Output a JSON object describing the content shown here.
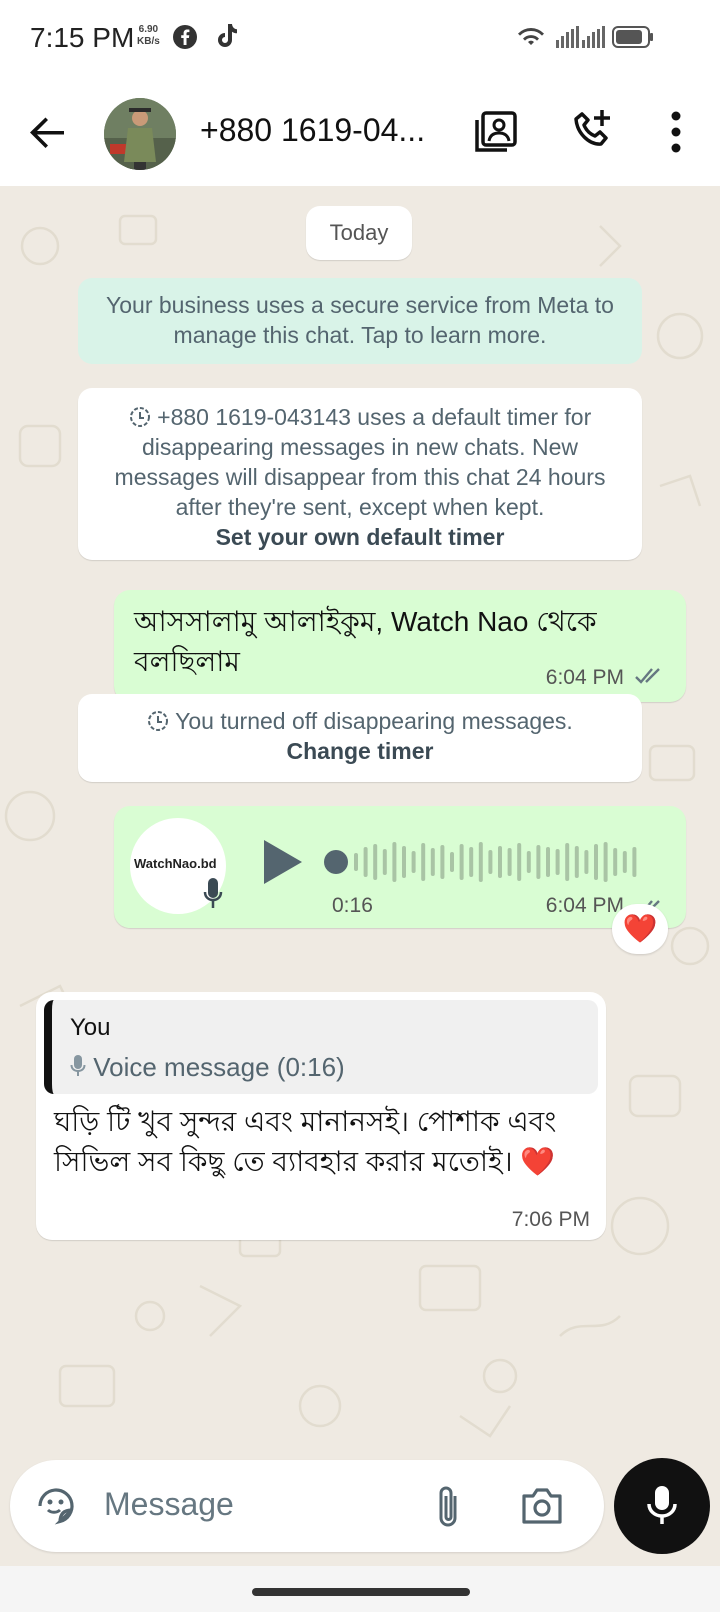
{
  "status_bar": {
    "time": "7:15 PM",
    "speed_value": "6.90",
    "speed_unit": "KB/s",
    "icons": [
      "facebook-icon",
      "tiktok-icon",
      "wifi-icon",
      "signal-icon",
      "signal-icon",
      "battery-icon"
    ]
  },
  "header": {
    "contact_name": "+880 1619-04...",
    "icons": [
      "back-arrow-icon",
      "catalog-icon",
      "add-call-icon",
      "more-vert-icon"
    ]
  },
  "chat": {
    "date_label": "Today",
    "business_notice": "Your business uses a secure service from Meta to manage this chat. Tap to learn more.",
    "timer_notice": "+880 1619-043143 uses a default timer for disappearing messages in new chats. New messages will disappear from this chat 24 hours after they're sent, except when kept.",
    "timer_link": "Set your own default timer",
    "messages": [
      {
        "direction": "out",
        "text": "আসসালামু আলাইকুম, Watch Nao থেকে বলছিলাম",
        "time": "6:04 PM",
        "status": "read"
      },
      {
        "direction": "out",
        "type": "voice",
        "duration": "0:16",
        "avatar_label": "WatchNao.bd",
        "time": "6:04 PM",
        "status": "read",
        "reaction": "❤️"
      },
      {
        "direction": "in",
        "quote_author": "You",
        "quote_text": "Voice message (0:16)",
        "text": "ঘড়ি টি খুব সুন্দর এবং মানানসই। পোশাক এবং সিভিল সব কিছু তে ব্যাবহার করার মতোই। ❤️",
        "time": "7:06 PM"
      }
    ],
    "turnoff_notice": "You turned off disappearing messages.",
    "turnoff_link": "Change timer"
  },
  "composer": {
    "placeholder": "Message",
    "icons": [
      "sticker-icon",
      "attach-icon",
      "camera-icon",
      "mic-icon"
    ]
  },
  "colors": {
    "chat_bg": "#efeae2",
    "outgoing_bubble": "#d9fdd3",
    "business_notice_bg": "#d9f3e8",
    "read_tick": "#667781"
  }
}
